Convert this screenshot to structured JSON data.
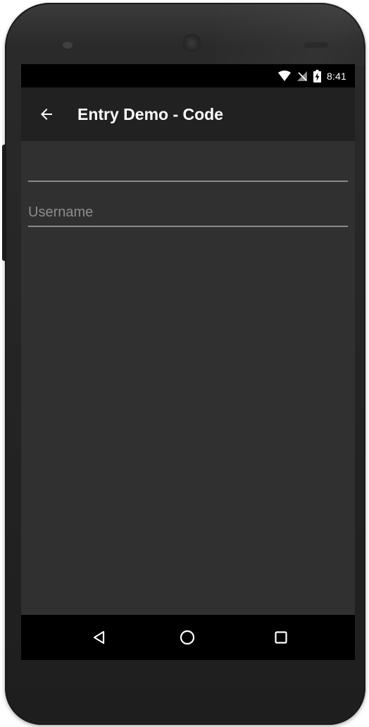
{
  "status_bar": {
    "time": "8:41",
    "icons": [
      "wifi-icon",
      "no-signal-icon",
      "battery-charging-icon"
    ]
  },
  "app_bar": {
    "back_icon": "arrow-back-icon",
    "title": "Entry Demo - Code"
  },
  "form": {
    "entry1": {
      "value": "",
      "placeholder": ""
    },
    "entry2": {
      "value": "",
      "placeholder": "Username"
    }
  },
  "nav_bar": {
    "icons": [
      "nav-back-icon",
      "nav-home-icon",
      "nav-recents-icon"
    ]
  },
  "colors": {
    "screen_background": "#303030",
    "app_bar": "#212121",
    "status_bar": "#000000",
    "nav_bar": "#000000",
    "underline": "#8a8a8a",
    "placeholder": "#8c8c8c"
  }
}
